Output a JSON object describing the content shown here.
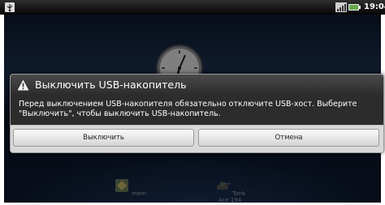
{
  "status_bar": {
    "time": "19:04",
    "icons": [
      "usb-icon",
      "signal-icon",
      "battery-icon"
    ]
  },
  "home": {
    "apps": [
      {
        "label": "mem",
        "icon": "app-mem-icon"
      },
      {
        "label": "Tank Ace 194",
        "icon": "app-tank-icon"
      }
    ]
  },
  "dialog": {
    "title": "Выключить USB-накопитель",
    "message": "Перед выключением USB-накопителя обязательно отключите USB-хост. Выберите \"Выключить\", чтобы выключить USB-накопитель.",
    "confirm_label": "Выключить",
    "cancel_label": "Отмена"
  },
  "colors": {
    "dialog_header": "#3a3a3a",
    "dialog_body": "#2c2c2c",
    "button_bar": "#d9d9d9"
  }
}
